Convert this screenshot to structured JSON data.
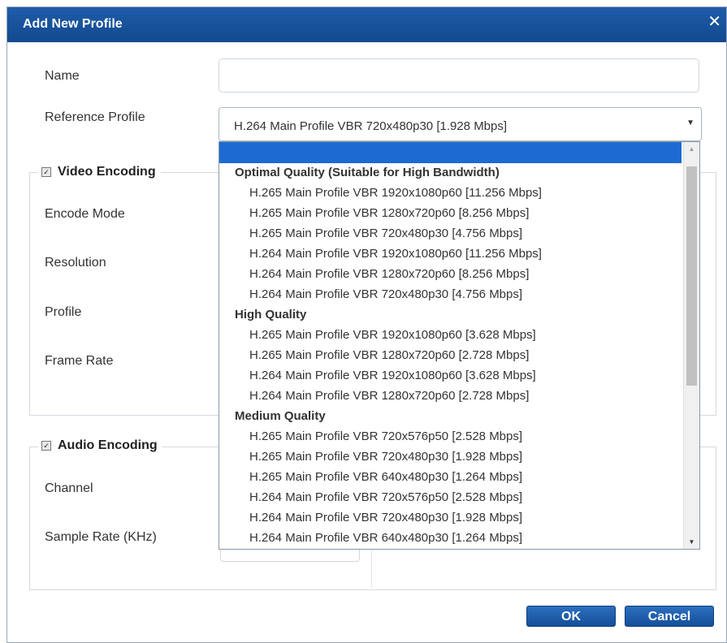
{
  "dialog": {
    "title": "Add New Profile",
    "close_glyph": "✕",
    "close_icon": "close-icon"
  },
  "form": {
    "name_label": "Name",
    "name_value": "",
    "reference_label": "Reference Profile",
    "reference_value": "H.264 Main Profile VBR 720x480p30 [1.928 Mbps]",
    "dropdown_arrow": "▼"
  },
  "video": {
    "legend": "Video Encoding",
    "checked": true,
    "labels": [
      "Encode Mode",
      "Resolution",
      "Profile",
      "Frame Rate"
    ]
  },
  "audio": {
    "legend": "Audio Encoding",
    "checked": true,
    "labels": [
      "Channel",
      "Sample Rate (KHz)"
    ]
  },
  "dropdown": {
    "groups": [
      {
        "label": "Optimal Quality (Suitable for High Bandwidth)",
        "items": [
          "H.265 Main Profile VBR 1920x1080p60 [11.256 Mbps]",
          "H.265 Main Profile VBR 1280x720p60 [8.256 Mbps]",
          "H.265 Main Profile VBR 720x480p30 [4.756 Mbps]",
          "H.264 Main Profile VBR 1920x1080p60 [11.256 Mbps]",
          "H.264 Main Profile VBR 1280x720p60 [8.256 Mbps]",
          "H.264 Main Profile VBR 720x480p30 [4.756 Mbps]"
        ]
      },
      {
        "label": "High Quality",
        "items": [
          "H.265 Main Profile VBR 1920x1080p60 [3.628 Mbps]",
          "H.265 Main Profile VBR 1280x720p60 [2.728 Mbps]",
          "H.264 Main Profile VBR 1920x1080p60 [3.628 Mbps]",
          "H.264 Main Profile VBR 1280x720p60 [2.728 Mbps]"
        ]
      },
      {
        "label": "Medium Quality",
        "items": [
          "H.265 Main Profile VBR 720x576p50 [2.528 Mbps]",
          "H.265 Main Profile VBR 720x480p30 [1.928 Mbps]",
          "H.265 Main Profile VBR 640x480p30 [1.264 Mbps]",
          "H.264 Main Profile VBR 720x576p50 [2.528 Mbps]",
          "H.264 Main Profile VBR 720x480p30 [1.928 Mbps]",
          "H.264 Main Profile VBR 640x480p30 [1.264 Mbps]"
        ]
      }
    ],
    "scroll_up": "▲",
    "scroll_down": "▼"
  },
  "buttons": {
    "ok": "OK",
    "cancel": "Cancel"
  },
  "colors": {
    "titlebar": "#174f98",
    "selection": "#1c6bd2",
    "button": "#1f5ca8"
  }
}
